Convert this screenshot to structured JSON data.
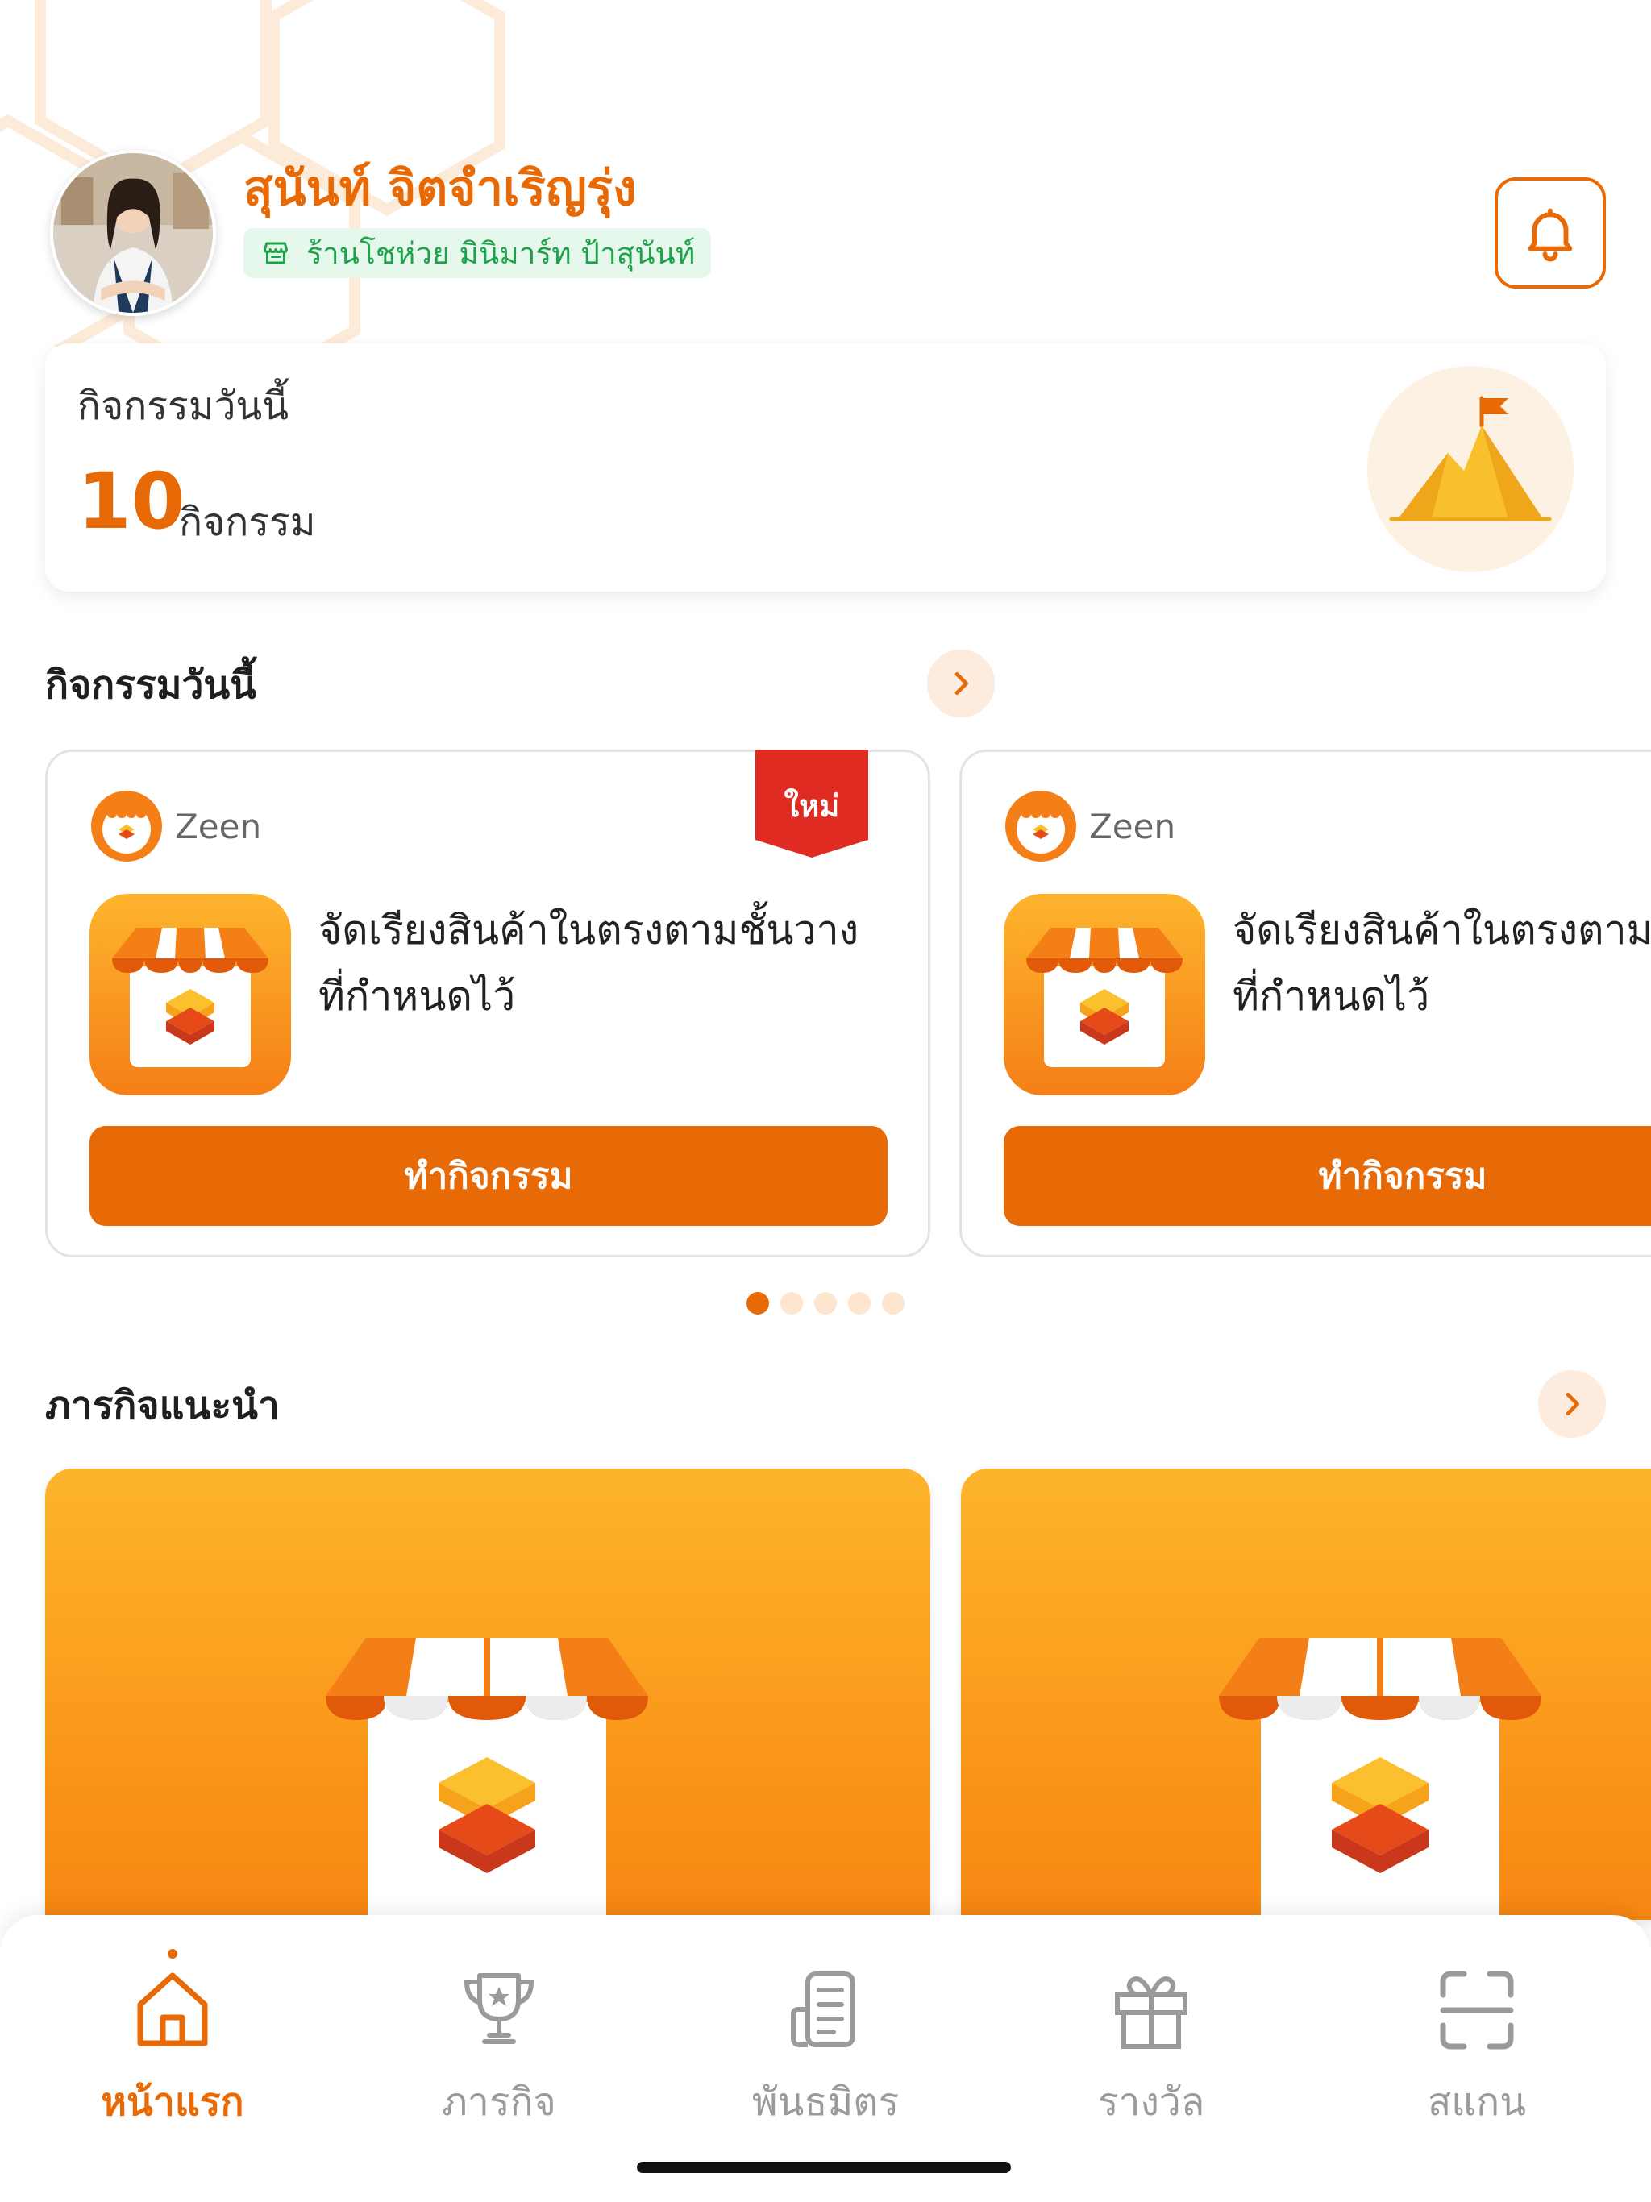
{
  "profile": {
    "name": "สุนันท์ จิตจำเริญรุ่ง",
    "store_name": "ร้านโชห่วย มินิมาร์ท ป้าสุนันท์"
  },
  "summary": {
    "label": "กิจกรรมวันนี้",
    "count": "10",
    "unit": "กิจกรรม"
  },
  "sections": {
    "today_title": "กิจกรรมวันนี้",
    "missions_title": "ภารกิจแนะนำ"
  },
  "activities": [
    {
      "brand": "Zeen",
      "badge": "ใหม่",
      "title": "จัดเรียงสินค้าในตรงตามชั้นวาง\nที่กำหนดไว้",
      "button": "ทำกิจกรรม"
    },
    {
      "brand": "Zeen",
      "title": "จัดเรียงสินค้าในตรงตามชั้นวาง\nที่กำหนดไว้",
      "button": "ทำกิจกรรม"
    }
  ],
  "pager": {
    "count": 5,
    "active": 1
  },
  "nav": {
    "items": [
      {
        "label": "หน้าแรก",
        "icon": "home-icon",
        "active": true
      },
      {
        "label": "ภารกิจ",
        "icon": "trophy-icon",
        "active": false
      },
      {
        "label": "พันธมิตร",
        "icon": "partner-building-icon",
        "active": false
      },
      {
        "label": "รางวัล",
        "icon": "gift-icon",
        "active": false
      },
      {
        "label": "สแกน",
        "icon": "scan-icon",
        "active": false
      }
    ]
  },
  "colors": {
    "accent": "#E86A06",
    "store_badge_text": "#1BA24B",
    "store_badge_bg": "#E6F7EB",
    "new_badge": "#E02B22",
    "mission_gradient_top": "#FDB52D",
    "mission_gradient_bottom": "#F68612"
  }
}
